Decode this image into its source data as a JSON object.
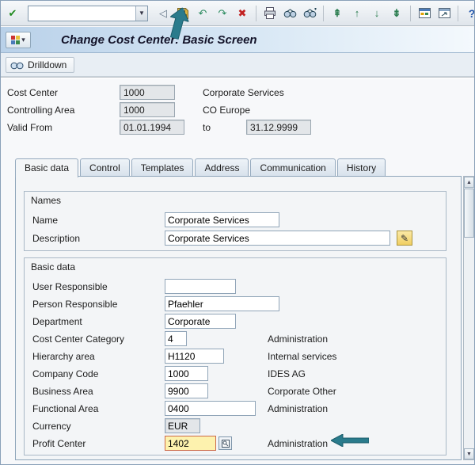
{
  "titlebar": {
    "title": "Change Cost Center: Basic Screen",
    "menu_arrow": "▾"
  },
  "toolbar": {
    "command_value": "",
    "glyphs": {
      "enter": "✔",
      "combo_arrow": "▼",
      "back_triangle": "◁",
      "undo": "↶",
      "redo": "↷",
      "cancel": "✖",
      "page_first": "⇞",
      "page_up": "↑",
      "page_down": "↓",
      "page_last": "⇟",
      "help": "?"
    },
    "svg_icon_names": [
      "save-icon",
      "print-icon",
      "find-icon",
      "find-next-icon",
      "new-session-icon",
      "shortcut-icon",
      "customize-layout-icon"
    ]
  },
  "app_toolbar": {
    "drilldown_label": "Drilldown"
  },
  "header": {
    "rows": [
      {
        "label": "Cost Center",
        "value": "1000",
        "text": "Corporate Services"
      },
      {
        "label": "Controlling Area",
        "value": "1000",
        "text": "CO Europe"
      },
      {
        "label": "Valid From",
        "value": "01.01.1994",
        "to_label": "to",
        "to_value": "31.12.9999"
      }
    ]
  },
  "tabs": {
    "active": "Basic data",
    "items": [
      "Basic data",
      "Control",
      "Templates",
      "Address",
      "Communication",
      "History"
    ]
  },
  "names_group": {
    "title": "Names",
    "name_label": "Name",
    "name_value": "Corporate Services",
    "description_label": "Description",
    "description_value": "Corporate Services",
    "edit_glyph": "✎"
  },
  "basic_group": {
    "title": "Basic data",
    "fields": [
      {
        "label": "User Responsible",
        "value": "",
        "text": ""
      },
      {
        "label": "Person Responsible",
        "value": "Pfaehler",
        "text": ""
      },
      {
        "label": "Department",
        "value": "Corporate",
        "text": ""
      },
      {
        "label": "Cost Center Category",
        "value": "4",
        "text": "Administration"
      },
      {
        "label": "Hierarchy area",
        "value": "H1120",
        "text": "Internal services"
      },
      {
        "label": "Company Code",
        "value": "1000",
        "text": "IDES AG"
      },
      {
        "label": "Business Area",
        "value": "9900",
        "text": "Corporate Other"
      },
      {
        "label": "Functional Area",
        "value": "0400",
        "text": "Administration"
      },
      {
        "label": "Currency",
        "value": "EUR",
        "text": ""
      },
      {
        "label": "Profit Center",
        "value": "1402",
        "text": "Administration"
      }
    ]
  },
  "scrollbar": {
    "up": "▲",
    "down": "▼"
  }
}
